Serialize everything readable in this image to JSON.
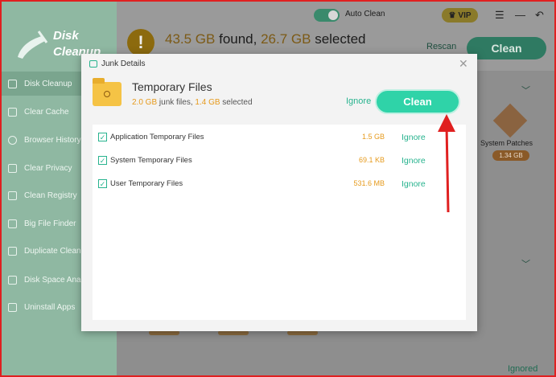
{
  "window": {
    "title": "Disk Cleanup"
  },
  "sidebar": {
    "logo_line1": "Disk",
    "logo_line2": "Cleanup",
    "items": [
      {
        "label": "Disk Cleanup",
        "icon": "disk-icon",
        "active": true
      },
      {
        "label": "Clear Cache",
        "icon": "cache-icon"
      },
      {
        "label": "Browser History",
        "icon": "globe-icon"
      },
      {
        "label": "Clear Privacy",
        "icon": "privacy-icon"
      },
      {
        "label": "Clean Registry",
        "icon": "registry-icon"
      },
      {
        "label": "Big File Finder",
        "icon": "folder-icon"
      },
      {
        "label": "Duplicate Cleaner",
        "icon": "duplicate-icon"
      },
      {
        "label": "Disk Space Analyzer",
        "icon": "chart-icon"
      },
      {
        "label": "Uninstall Apps",
        "icon": "apps-icon"
      }
    ]
  },
  "topbar": {
    "auto_clean_label": "Auto Clean",
    "auto_clean_on": true,
    "vip_label": "VIP",
    "menu_icon": "☰",
    "minimize_icon": "—",
    "back_icon": "↶"
  },
  "scan": {
    "found_amount": "43.5 GB",
    "found_word": " found, ",
    "selected_amount": "26.7 GB",
    "selected_word": " selected",
    "rescan_label": "Rescan",
    "clean_label": "Clean",
    "warning_icon": "!"
  },
  "background_panel": {
    "system_patches_label": "System Patches",
    "system_patches_size": "1.34 GB",
    "ignored_label": "Ignored"
  },
  "dialog": {
    "title": "Junk Details",
    "close_icon": "✕",
    "category_title": "Temporary Files",
    "junk_amount": "2.0 GB",
    "junk_word": " junk files, ",
    "selected_amount": "1.4 GB",
    "selected_word": " selected",
    "ignore_label": "Ignore",
    "clean_label": "Clean",
    "items": [
      {
        "name": "Application Temporary Files",
        "size": "1.5 GB",
        "checked": true,
        "ignore": "Ignore"
      },
      {
        "name": "System Temporary Files",
        "size": "69.1 KB",
        "checked": true,
        "ignore": "Ignore"
      },
      {
        "name": "User Temporary Files",
        "size": "531.6 MB",
        "checked": true,
        "ignore": "Ignore"
      }
    ]
  },
  "colors": {
    "accent": "#2fd3a8",
    "amount_orange": "#e69a1c",
    "annotation_red": "#e02020"
  }
}
